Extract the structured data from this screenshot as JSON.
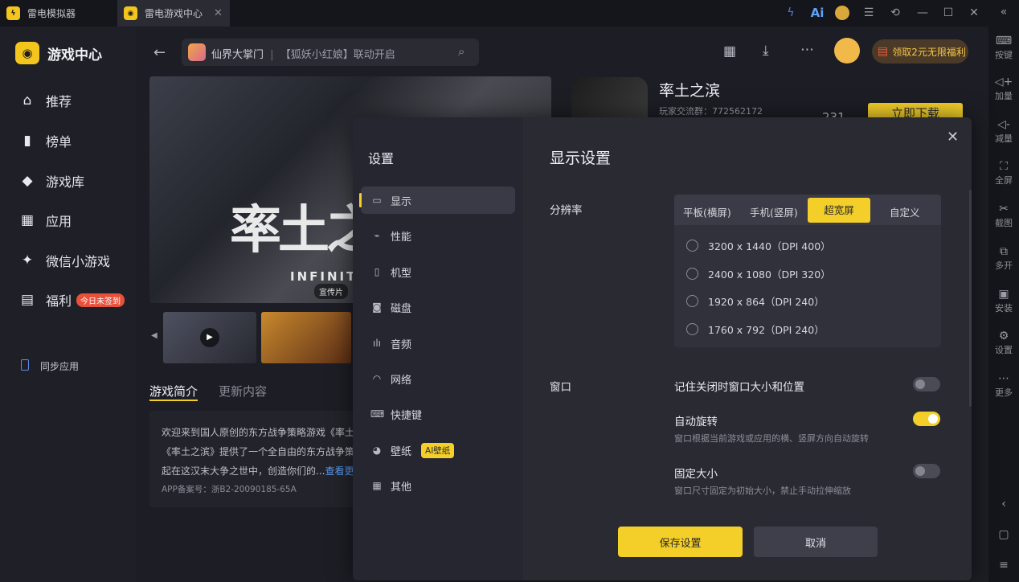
{
  "titlebar": {
    "tabs": [
      {
        "label": "雷电模拟器",
        "icon": "ld-logo-icon"
      },
      {
        "label": "雷电游戏中心",
        "icon": "gamepad-icon"
      }
    ],
    "ai_label": "Ai"
  },
  "rail": {
    "items": [
      {
        "label": "按键",
        "icon": "keyboard-icon"
      },
      {
        "label": "加量",
        "icon": "volume-up-icon"
      },
      {
        "label": "减量",
        "icon": "volume-down-icon"
      },
      {
        "label": "全屏",
        "icon": "fullscreen-icon"
      },
      {
        "label": "截图",
        "icon": "scissors-icon"
      },
      {
        "label": "多开",
        "icon": "multi-instance-icon"
      },
      {
        "label": "安装",
        "icon": "apk-install-icon"
      },
      {
        "label": "设置",
        "icon": "gear-icon"
      },
      {
        "label": "更多",
        "icon": "more-icon"
      }
    ]
  },
  "sidebar": {
    "app_title": "游戏中心",
    "items": [
      {
        "label": "推荐",
        "icon": "home-icon"
      },
      {
        "label": "榜单",
        "icon": "chart-icon"
      },
      {
        "label": "游戏库",
        "icon": "gamepad-icon"
      },
      {
        "label": "应用",
        "icon": "apps-icon"
      },
      {
        "label": "微信小游戏",
        "icon": "wechat-game-icon"
      },
      {
        "label": "福利",
        "icon": "gift-icon",
        "badge": "今日未签到"
      }
    ],
    "sync": "同步应用"
  },
  "header": {
    "search_game": "仙界大掌门",
    "search_sep": "|",
    "search_text": "【狐妖小红娘】联动开启",
    "promo": "领取2元无限福利"
  },
  "game": {
    "title": "率土之滨",
    "group": "玩家交流群：772562172",
    "download": "立即下载",
    "count": "231",
    "hero_text": "率土之",
    "hero_sub": "INFINITE",
    "hero_badge": "宣传片",
    "tabs": [
      "游戏简介",
      "更新内容"
    ],
    "desc_lines": [
      "欢迎来到国人原创的东方战争策略游戏《率土",
      "《率土之滨》提供了一个全自由的东方战争策",
      "起在这汉末大争之世中，创造你们的..."
    ],
    "more": "查看更",
    "record": "APP备案号：浙B2-20090185-65A"
  },
  "modal": {
    "left_title": "设置",
    "nav": [
      {
        "label": "显示",
        "icon": "monitor-icon",
        "active": true
      },
      {
        "label": "性能",
        "icon": "performance-icon"
      },
      {
        "label": "机型",
        "icon": "phone-icon"
      },
      {
        "label": "磁盘",
        "icon": "disk-icon"
      },
      {
        "label": "音频",
        "icon": "audio-icon"
      },
      {
        "label": "网络",
        "icon": "wifi-icon"
      },
      {
        "label": "快捷键",
        "icon": "keyboard-icon"
      },
      {
        "label": "壁纸",
        "icon": "palette-icon",
        "badge": "AI壁纸"
      },
      {
        "label": "其他",
        "icon": "grid-icon"
      }
    ],
    "title": "显示设置",
    "resolution_label": "分辨率",
    "res_tabs": [
      "平板(横屏)",
      "手机(竖屏)",
      "超宽屏",
      "自定义"
    ],
    "res_active": 2,
    "res_options": [
      "3200 x 1440（DPI 400）",
      "2400 x 1080（DPI 320）",
      "1920 x 864（DPI 240）",
      "1760 x 792（DPI 240）"
    ],
    "window_label": "窗口",
    "window_options": [
      {
        "label": "记住关闭时窗口大小和位置",
        "desc": "",
        "on": false
      },
      {
        "label": "自动旋转",
        "desc": "窗口根据当前游戏或应用的横、竖屏方向自动旋转",
        "on": true
      },
      {
        "label": "固定大小",
        "desc": "窗口尺寸固定为初始大小，禁止手动拉伸缩放",
        "on": false
      }
    ],
    "save": "保存设置",
    "cancel": "取消",
    "accent": "#f4cf2a"
  }
}
